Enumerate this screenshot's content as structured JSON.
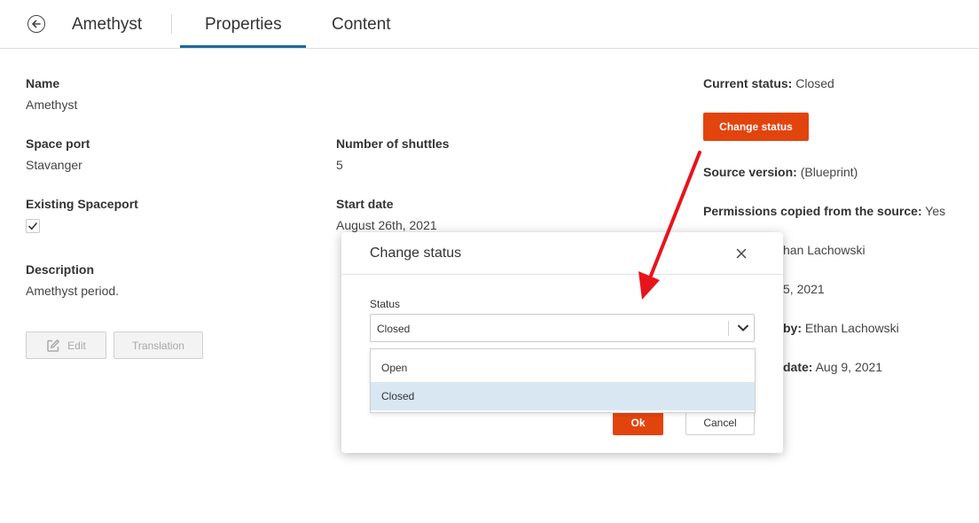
{
  "header": {
    "title": "Amethyst",
    "tabs": [
      {
        "label": "Properties",
        "active": true
      },
      {
        "label": "Content",
        "active": false
      }
    ]
  },
  "fields": {
    "name": {
      "label": "Name",
      "value": "Amethyst"
    },
    "space_port": {
      "label": "Space port",
      "value": "Stavanger"
    },
    "existing_spaceport": {
      "label": "Existing Spaceport",
      "checked": true
    },
    "description": {
      "label": "Description",
      "value": "Amethyst period."
    },
    "number_of_shuttles": {
      "label": "Number of shuttles",
      "value": "5"
    },
    "start_date": {
      "label": "Start date",
      "value": "August 26th, 2021"
    }
  },
  "actions": {
    "edit_label": "Edit",
    "translation_label": "Translation"
  },
  "right_panel": {
    "current_status_label": "Current status:",
    "current_status_value": "Closed",
    "change_status_label": "Change status",
    "source_version_label": "Source version:",
    "source_version_value": "(Blueprint)",
    "permissions_label": "Permissions copied from the source:",
    "permissions_value": "Yes",
    "partial_1": "han Lachowski",
    "partial_2": "5, 2021",
    "partial_3_label": "by:",
    "partial_3_value": "Ethan Lachowski",
    "partial_4_label": "date:",
    "partial_4_value": "Aug 9, 2021"
  },
  "modal": {
    "title": "Change status",
    "status_label": "Status",
    "selected_value": "Closed",
    "options": [
      "Open",
      "Closed"
    ],
    "ok_label": "Ok",
    "cancel_label": "Cancel"
  },
  "colors": {
    "accent": "#e2440e",
    "tab_underline": "#1f6a9a",
    "selected_option_bg": "#d9e7f3",
    "annotation_arrow": "#e8141b"
  },
  "icons": [
    "back-arrow-circle-icon",
    "checkmark-icon",
    "pencil-icon",
    "close-icon",
    "chevron-down-icon"
  ]
}
